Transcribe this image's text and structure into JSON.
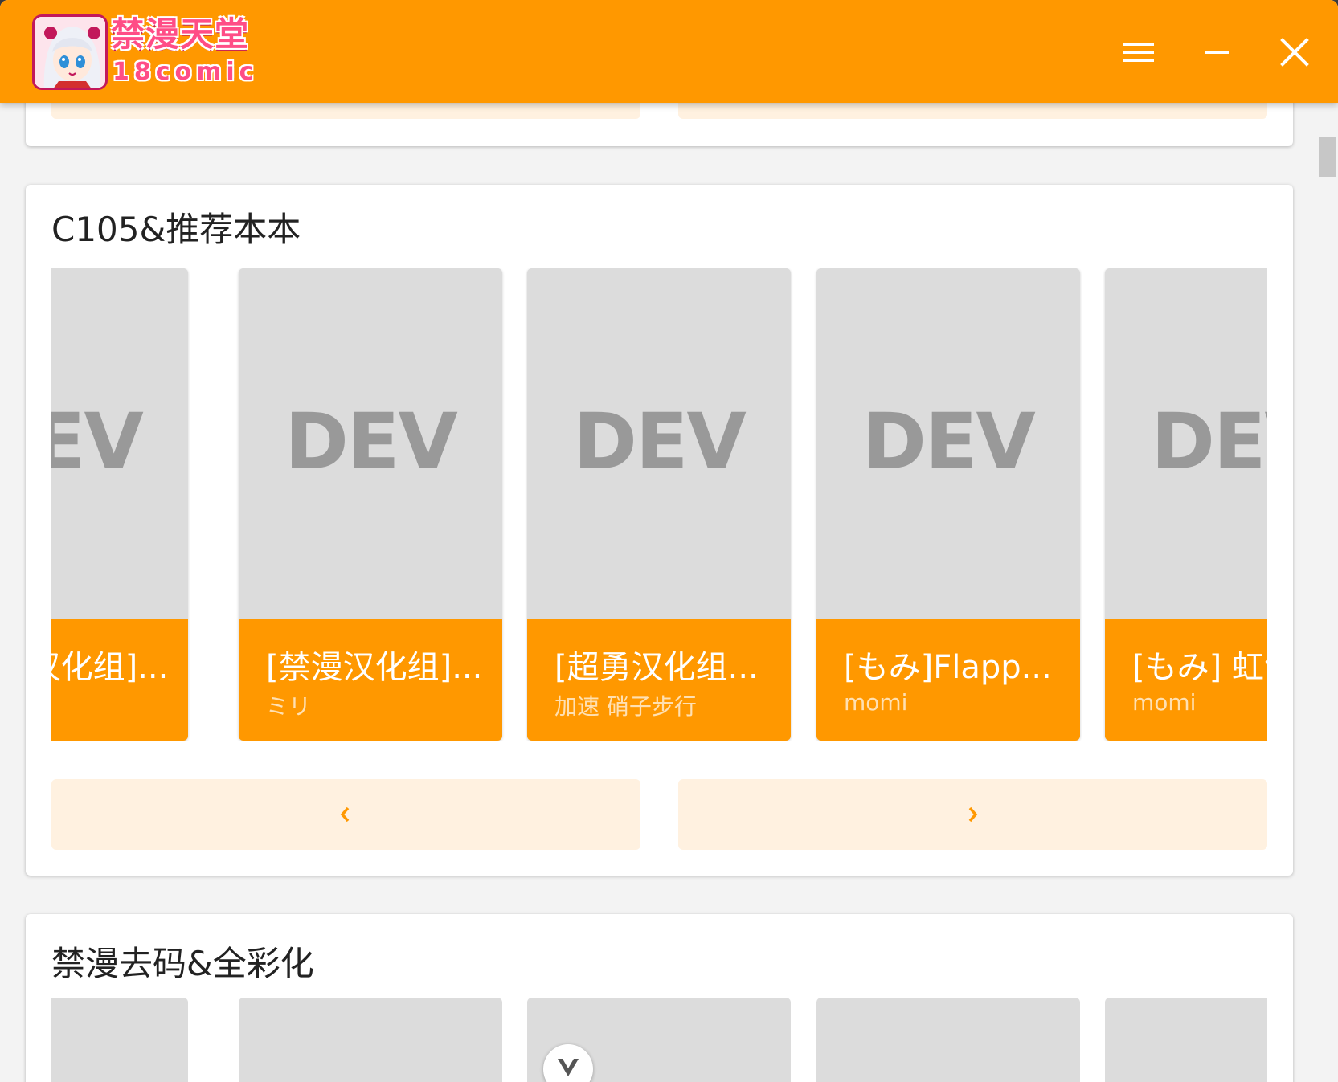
{
  "app": {
    "logo_title": "禁漫天堂",
    "logo_subtitle": "18comic"
  },
  "window_controls": {
    "menu_icon": "hamburger-icon",
    "minimize_icon": "minimize-icon",
    "close_icon": "close-icon"
  },
  "colors": {
    "accent": "#ff9800",
    "pager_bg": "#fff1e0",
    "placeholder": "#dcdcdc"
  },
  "sections": [
    {
      "title": "C105&推荐本本",
      "comics": [
        {
          "cover_text": "DEV",
          "title": "[禁漫汉化组]...",
          "author": ""
        },
        {
          "cover_text": "DEV",
          "title": "[禁漫汉化组]...",
          "author": "ミリ"
        },
        {
          "cover_text": "DEV",
          "title": "[超勇汉化组...",
          "author": "加速 硝子步行"
        },
        {
          "cover_text": "DEV",
          "title": "[もみ]Flapp...",
          "author": "momi"
        },
        {
          "cover_text": "DEV",
          "title": "[もみ] 虹色",
          "author": "momi"
        }
      ],
      "prev_icon": "chevron-left-icon",
      "next_icon": "chevron-right-icon"
    },
    {
      "title": "禁漫去码&全彩化"
    }
  ],
  "scroll_down_icon": "chevron-down-icon"
}
